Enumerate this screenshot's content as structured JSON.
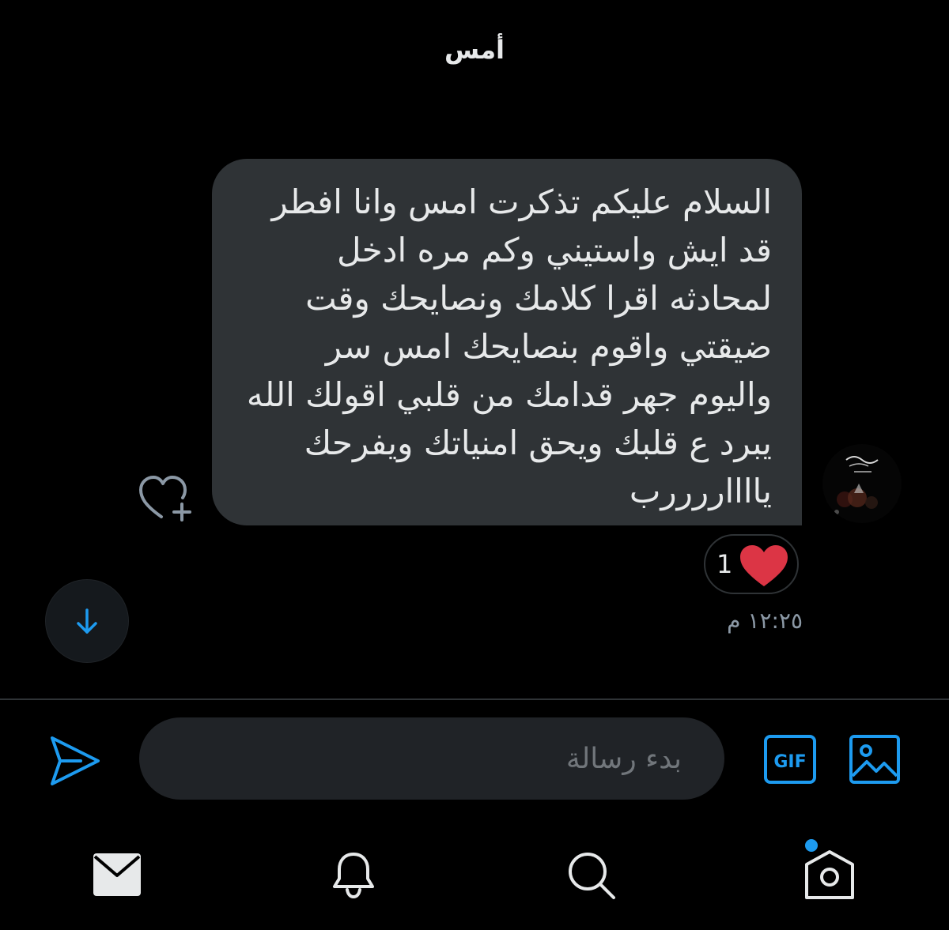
{
  "conversation": {
    "day_label": "أمس"
  },
  "message": {
    "lines": [
      "السلام عليكم تذكرت امس وانا افطر",
      "قد ايش واستيني وكم مره ادخل",
      "لمحادثه اقرا كلامك ونصايحك وقت",
      "ضيقتي واقوم بنصايحك امس سر",
      "واليوم جهر قدامك من قلبي اقولك الله",
      "يبرد ع قلبك ويحق امنياتك ويفرحك",
      "يااااررررب"
    ],
    "reaction_count": "1",
    "timestamp": "١٢:٢٥ م"
  },
  "composer": {
    "placeholder": "بدء رسالة",
    "gif_label": "GIF"
  },
  "icons": {
    "add_reaction": "heart-plus-icon",
    "reaction": "heart-icon",
    "scroll_down": "arrow-down-icon",
    "send": "send-icon",
    "gif": "gif-icon",
    "image": "image-icon",
    "nav": [
      "mail-icon",
      "bell-icon",
      "search-icon",
      "spaces-icon"
    ]
  },
  "colors": {
    "background": "#000000",
    "bubble": "#2f3336",
    "accent": "#1d9bf0",
    "heart": "#f91880",
    "muted": "#71767b"
  }
}
